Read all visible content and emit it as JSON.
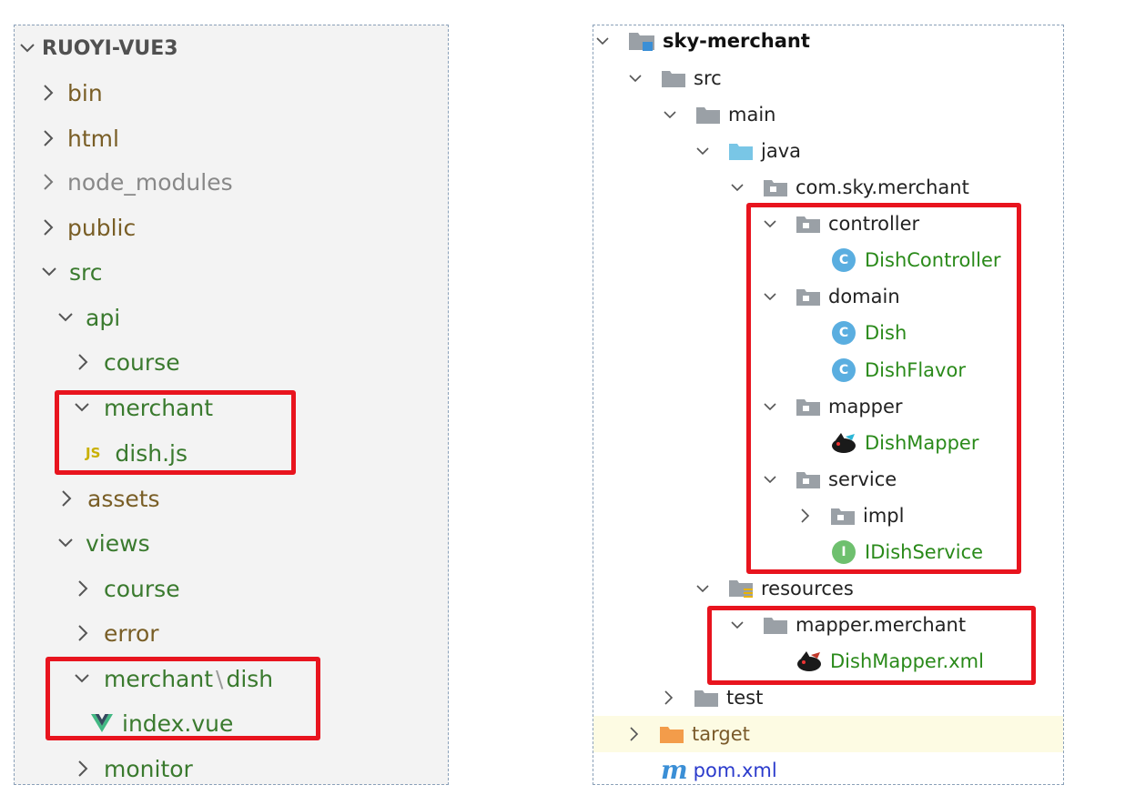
{
  "colors": {
    "left_folder_text": "#795e26",
    "left_green_text": "#3a7a2e",
    "left_muted_text": "#888888",
    "left_root_text": "#505050",
    "js_badge": "#c9b000",
    "vue_logo": "#41b883",
    "right_class_text": "#2a8a1a",
    "right_target_text": "#7a5a2a",
    "right_pom_text": "#2b3bcc",
    "highlight_border": "#e8141e",
    "class_badge": "#5aaee0",
    "interface_badge": "#6ec06e",
    "folder_gray": "#9aa0a6",
    "folder_blue": "#79c6e6",
    "folder_orange": "#f39c4a"
  },
  "left_tree": {
    "root": "RUOYI-VUE3",
    "items": [
      {
        "label": "bin",
        "state": "collapsed"
      },
      {
        "label": "html",
        "state": "collapsed"
      },
      {
        "label": "node_modules",
        "state": "collapsed"
      },
      {
        "label": "public",
        "state": "collapsed"
      },
      {
        "label": "src",
        "state": "expanded"
      },
      {
        "label": "api",
        "state": "expanded"
      },
      {
        "label": "course",
        "state": "collapsed"
      },
      {
        "label": "merchant",
        "state": "expanded"
      },
      {
        "label": "dish.js",
        "icon": "js-file-icon",
        "badge": "JS"
      },
      {
        "label": "assets",
        "state": "collapsed"
      },
      {
        "label": "views",
        "state": "expanded"
      },
      {
        "label": "course",
        "state": "collapsed"
      },
      {
        "label": "error",
        "state": "collapsed"
      },
      {
        "label": "merchant",
        "separator": "\\",
        "label_suffix": "dish",
        "state": "expanded"
      },
      {
        "label": "index.vue",
        "icon": "vue-file-icon"
      },
      {
        "label": "monitor",
        "state": "collapsed"
      }
    ]
  },
  "right_tree": {
    "items": [
      {
        "label": "sky-merchant",
        "icon": "module-folder-icon",
        "state": "expanded"
      },
      {
        "label": "src",
        "icon": "folder-icon",
        "state": "expanded"
      },
      {
        "label": "main",
        "icon": "folder-icon",
        "state": "expanded"
      },
      {
        "label": "java",
        "icon": "source-folder-icon",
        "state": "expanded"
      },
      {
        "label": "com.sky.merchant",
        "icon": "package-icon",
        "state": "expanded"
      },
      {
        "label": "controller",
        "icon": "package-icon",
        "state": "expanded"
      },
      {
        "label": "DishController",
        "icon": "class-icon",
        "badge": "C"
      },
      {
        "label": "domain",
        "icon": "package-icon",
        "state": "expanded"
      },
      {
        "label": "Dish",
        "icon": "class-icon",
        "badge": "C"
      },
      {
        "label": "DishFlavor",
        "icon": "class-icon",
        "badge": "C"
      },
      {
        "label": "mapper",
        "icon": "package-icon",
        "state": "expanded"
      },
      {
        "label": "DishMapper",
        "icon": "mybatis-icon"
      },
      {
        "label": "service",
        "icon": "package-icon",
        "state": "expanded"
      },
      {
        "label": "impl",
        "icon": "package-icon",
        "state": "collapsed"
      },
      {
        "label": "IDishService",
        "icon": "interface-icon",
        "badge": "I"
      },
      {
        "label": "resources",
        "icon": "resources-folder-icon",
        "state": "expanded"
      },
      {
        "label": "mapper.merchant",
        "icon": "folder-icon",
        "state": "expanded"
      },
      {
        "label": "DishMapper.xml",
        "icon": "mybatis-icon"
      },
      {
        "label": "test",
        "icon": "folder-icon",
        "state": "collapsed"
      },
      {
        "label": "target",
        "icon": "excluded-folder-icon",
        "state": "collapsed"
      },
      {
        "label": "pom.xml",
        "icon": "maven-icon",
        "badge": "m"
      }
    ]
  }
}
